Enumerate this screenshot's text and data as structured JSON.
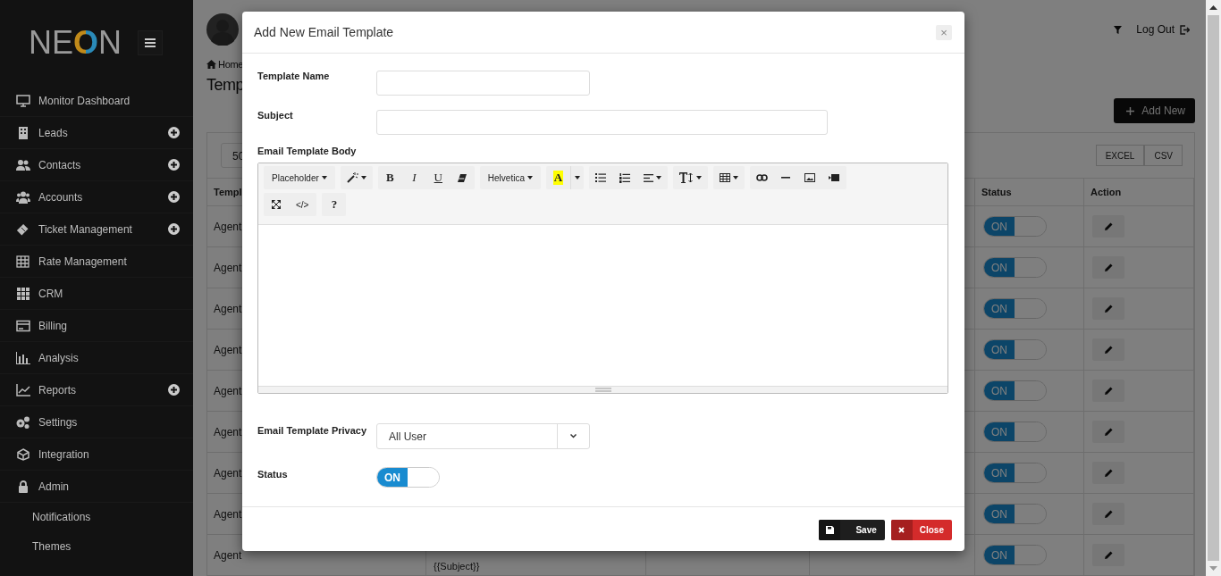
{
  "sidebar": {
    "logo": "NEON",
    "items": [
      {
        "label": "Monitor Dashboard",
        "kind": "monitor",
        "expandable": false
      },
      {
        "label": "Leads",
        "kind": "building",
        "expandable": true
      },
      {
        "label": "Contacts",
        "kind": "users",
        "expandable": true
      },
      {
        "label": "Accounts",
        "kind": "group",
        "expandable": true
      },
      {
        "label": "Ticket Management",
        "kind": "ticket",
        "expandable": true
      },
      {
        "label": "Rate Management",
        "kind": "table",
        "expandable": false
      },
      {
        "label": "CRM",
        "kind": "apps",
        "expandable": false
      },
      {
        "label": "Billing",
        "kind": "card",
        "expandable": false
      },
      {
        "label": "Analysis",
        "kind": "bars",
        "expandable": false
      },
      {
        "label": "Reports",
        "kind": "chart",
        "expandable": true
      },
      {
        "label": "Settings",
        "kind": "gears",
        "expandable": false
      },
      {
        "label": "Integration",
        "kind": "cube",
        "expandable": false
      },
      {
        "label": "Admin",
        "kind": "lock",
        "expandable": false,
        "children": [
          {
            "label": "Notifications"
          },
          {
            "label": "Themes"
          }
        ]
      }
    ]
  },
  "header": {
    "logout": "Log Out"
  },
  "breadcrumb": "Home",
  "page_title": "Temp",
  "add_button": "Add New",
  "table": {
    "page_size": "50",
    "exports": [
      "EXCEL",
      "CSV"
    ],
    "columns": [
      {
        "label": "Templ"
      },
      {
        "label": "Status"
      },
      {
        "label": "Action"
      }
    ],
    "rows": [
      {
        "name": "Agent",
        "status": "ON",
        "on": true
      },
      {
        "name": "Agent",
        "status": "ON",
        "on": true
      },
      {
        "name": "Agent",
        "status": "ON",
        "on": true
      },
      {
        "name": "Agent",
        "status": "ON",
        "on": true
      },
      {
        "name": "Agent",
        "status": "ON",
        "on": true
      },
      {
        "name": "Agent",
        "status": "ON",
        "on": true
      },
      {
        "name": "Agent",
        "status": "ON",
        "on": true
      },
      {
        "name": "Agent",
        "status": "ON",
        "on": true
      },
      {
        "name": "Agent",
        "subject": "{{Subject}}",
        "status": "ON",
        "on": true
      }
    ]
  },
  "modal": {
    "title": "Add New Email Template",
    "close_symbol": "×",
    "fields": [
      {
        "label": "Template Name"
      },
      {
        "label": "Subject"
      }
    ],
    "body_label": "Email Template Body",
    "toolbar": [
      [
        [
          {
            "kind": "text",
            "label": "Placeholder",
            "caret": true
          }
        ],
        [
          {
            "kind": "magic",
            "caret": true
          }
        ],
        [
          {
            "kind": "bold",
            "label": "B"
          },
          {
            "kind": "italic",
            "label": "I"
          },
          {
            "kind": "underline",
            "label": "U"
          },
          {
            "kind": "eraser"
          }
        ],
        [
          {
            "kind": "text",
            "label": "Helvetica",
            "caret": true
          }
        ],
        [
          {
            "kind": "color",
            "label": "A"
          },
          {
            "kind": "caret"
          }
        ],
        [
          {
            "kind": "ul"
          },
          {
            "kind": "ol"
          },
          {
            "kind": "align",
            "caret": true
          }
        ],
        [
          {
            "kind": "fontsize",
            "caret": true
          }
        ],
        [
          {
            "kind": "table",
            "caret": true
          }
        ],
        [
          {
            "kind": "link"
          },
          {
            "kind": "hr"
          },
          {
            "kind": "image"
          },
          {
            "kind": "video"
          }
        ]
      ],
      [
        [
          {
            "kind": "fullscreen"
          },
          {
            "kind": "text",
            "label": "</>"
          }
        ],
        [
          {
            "kind": "bold",
            "label": "?"
          }
        ]
      ]
    ],
    "privacy": {
      "label": "Email Template Privacy",
      "value": "All User"
    },
    "status": {
      "label": "Status",
      "text": "ON",
      "on": true
    },
    "buttons": [
      {
        "label": "Save",
        "kind": "save"
      },
      {
        "label": "Close",
        "kind": "close"
      }
    ]
  }
}
